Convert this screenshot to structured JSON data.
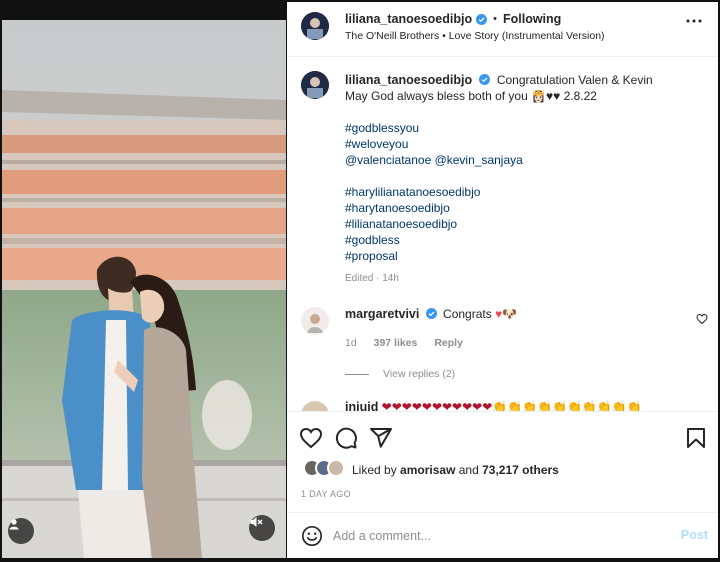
{
  "header": {
    "username": "liliana_tanoesoedibjo",
    "separator": "•",
    "follow_status": "Following",
    "audio": "The O'Neill Brothers • Love Story (Instrumental Version)"
  },
  "caption": {
    "username": "liliana_tanoesoedibjo",
    "line1": "Congratulation Valen & Kevin",
    "line2": "May God always bless both of you 👸🏻♥♥ 2.8.22",
    "tags_a": [
      "#godblessyou",
      "#weloveyou",
      "@valenciatanoe @kevin_sanjaya"
    ],
    "tags_b": [
      "#harylilianatanoesoedibjo",
      "#harytanoesoedibjo",
      "#lilianatanoesoedibjo",
      "#godbless",
      "#proposal"
    ],
    "edited": "Edited · 14h"
  },
  "comments": [
    {
      "username": "margaretvivi",
      "text": "Congrats",
      "heart": "♥",
      "extra": "🐶",
      "time": "1d",
      "likes": "397 likes",
      "reply": "Reply",
      "view_replies": "View replies (2)"
    },
    {
      "username": "iniuid",
      "text": "❤❤❤❤❤❤❤❤❤❤❤👏👏👏👏👏👏👏👏👏👏"
    }
  ],
  "likes": {
    "prefix": "Liked by",
    "user": "amorisaw",
    "middle": "and",
    "others": "73,217 others"
  },
  "date": "1 DAY AGO",
  "add_comment": {
    "placeholder": "Add a comment...",
    "post_label": "Post"
  },
  "colors": {
    "link": "#00376b",
    "verified": "#3897f0",
    "heart": "#ed4956",
    "post_disabled": "#b2dffc"
  }
}
